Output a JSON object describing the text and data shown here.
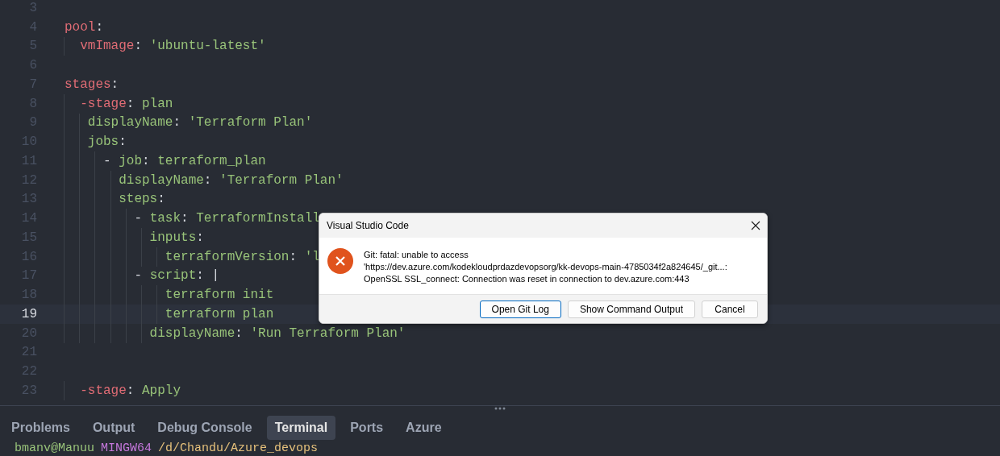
{
  "editor": {
    "lines": [
      {
        "number": "3",
        "selected": false
      },
      {
        "number": "4",
        "selected": false,
        "tokens": [
          {
            "kind": "keyword",
            "text": "pool"
          },
          {
            "kind": "punct",
            "text": ":"
          }
        ]
      },
      {
        "number": "5",
        "selected": false,
        "tokens": [
          {
            "kind": "keyword",
            "text": "  vmImage"
          },
          {
            "kind": "punct",
            "text": ": "
          },
          {
            "kind": "string",
            "text": "'ubuntu-latest'"
          }
        ]
      },
      {
        "number": "6",
        "selected": false
      },
      {
        "number": "7",
        "selected": false,
        "tokens": [
          {
            "kind": "keyword",
            "text": "stages"
          },
          {
            "kind": "punct",
            "text": ":"
          }
        ]
      },
      {
        "number": "8",
        "selected": false,
        "tokens": [
          {
            "kind": "keyword",
            "text": "  -stage"
          },
          {
            "kind": "punct",
            "text": ": "
          },
          {
            "kind": "string",
            "text": "plan"
          }
        ]
      },
      {
        "number": "9",
        "selected": false,
        "tokens": [
          {
            "kind": "string",
            "text": "   displayName"
          },
          {
            "kind": "punct",
            "text": ": "
          },
          {
            "kind": "string",
            "text": "'Terraform Plan'"
          }
        ]
      },
      {
        "number": "10",
        "selected": false,
        "tokens": [
          {
            "kind": "string",
            "text": "   jobs"
          },
          {
            "kind": "punct",
            "text": ":"
          }
        ]
      },
      {
        "number": "11",
        "selected": false,
        "tokens": [
          {
            "kind": "punct",
            "text": "     - "
          },
          {
            "kind": "string",
            "text": "job"
          },
          {
            "kind": "punct",
            "text": ": "
          },
          {
            "kind": "string",
            "text": "terraform_plan"
          }
        ]
      },
      {
        "number": "12",
        "selected": false,
        "tokens": [
          {
            "kind": "string",
            "text": "       displayName"
          },
          {
            "kind": "punct",
            "text": ": "
          },
          {
            "kind": "string",
            "text": "'Terraform Plan'"
          }
        ]
      },
      {
        "number": "13",
        "selected": false,
        "tokens": [
          {
            "kind": "string",
            "text": "       steps"
          },
          {
            "kind": "punct",
            "text": ":"
          }
        ]
      },
      {
        "number": "14",
        "selected": false,
        "tokens": [
          {
            "kind": "punct",
            "text": "         - "
          },
          {
            "kind": "string",
            "text": "task"
          },
          {
            "kind": "punct",
            "text": ": "
          },
          {
            "kind": "string",
            "text": "TerraformInstall"
          }
        ]
      },
      {
        "number": "15",
        "selected": false,
        "tokens": [
          {
            "kind": "string",
            "text": "           inputs"
          },
          {
            "kind": "punct",
            "text": ":"
          }
        ]
      },
      {
        "number": "16",
        "selected": false,
        "tokens": [
          {
            "kind": "string",
            "text": "             terraformVersion"
          },
          {
            "kind": "punct",
            "text": ": "
          },
          {
            "kind": "string",
            "text": "'l"
          }
        ]
      },
      {
        "number": "17",
        "selected": false,
        "tokens": [
          {
            "kind": "punct",
            "text": "         - "
          },
          {
            "kind": "string",
            "text": "script"
          },
          {
            "kind": "punct",
            "text": ": "
          },
          {
            "kind": "punct",
            "text": "|"
          }
        ]
      },
      {
        "number": "18",
        "selected": false,
        "tokens": [
          {
            "kind": "string",
            "text": "             terraform init"
          }
        ]
      },
      {
        "number": "19",
        "selected": true,
        "tokens": [
          {
            "kind": "string",
            "text": "             terraform plan"
          }
        ]
      },
      {
        "number": "20",
        "selected": false,
        "tokens": [
          {
            "kind": "string",
            "text": "           displayName"
          },
          {
            "kind": "punct",
            "text": ": "
          },
          {
            "kind": "string",
            "text": "'Run Terraform Plan'"
          }
        ]
      },
      {
        "number": "21",
        "selected": false
      },
      {
        "number": "22",
        "selected": false
      },
      {
        "number": "23",
        "selected": false,
        "tokens": [
          {
            "kind": "keyword",
            "text": "  -stage"
          },
          {
            "kind": "punct",
            "text": ": "
          },
          {
            "kind": "string",
            "text": "Apply"
          }
        ]
      }
    ]
  },
  "panel": {
    "tabs": [
      {
        "label": "Problems",
        "selected": false
      },
      {
        "label": "Output",
        "selected": false
      },
      {
        "label": "Debug Console",
        "selected": false
      },
      {
        "label": "Terminal",
        "selected": true
      },
      {
        "label": "Ports",
        "selected": false
      },
      {
        "label": "Azure",
        "selected": false
      }
    ],
    "terminal_prompt": [
      {
        "kind": "user",
        "text": "bmanv@Manuu"
      },
      {
        "kind": "system",
        "text": "MINGW64"
      },
      {
        "kind": "path",
        "text": "/d/Chandu/Azure_devops"
      }
    ]
  },
  "dialog": {
    "title": "Visual Studio Code",
    "message_lines": [
      "Git: fatal: unable to access",
      "'https://dev.azure.com/kodekloudprdazdevopsorg/kk-devops-main-4785034f2a824645/_git...:",
      "OpenSSL SSL_connect: Connection was reset in connection to dev.azure.com:443"
    ],
    "buttons": [
      {
        "label": "Open Git Log",
        "selected": true
      },
      {
        "label": "Show Command Output",
        "selected": false
      },
      {
        "label": "Cancel",
        "selected": false
      }
    ]
  }
}
